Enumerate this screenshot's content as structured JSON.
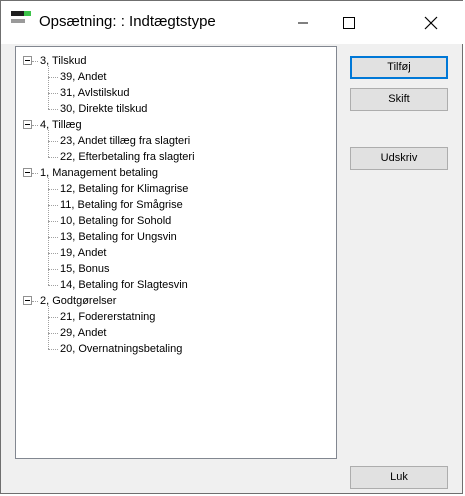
{
  "window": {
    "title": "Opsætning: : Indtægtstype"
  },
  "buttons": {
    "add": "Tilføj",
    "change": "Skift",
    "print": "Udskriv",
    "close": "Luk"
  },
  "tree": [
    {
      "label": "3, Tilskud",
      "children": [
        "39, Andet",
        "31, Avlstilskud",
        "30, Direkte tilskud"
      ]
    },
    {
      "label": "4, Tillæg",
      "children": [
        "23, Andet tillæg fra slagteri",
        "22, Efterbetaling fra slagteri"
      ]
    },
    {
      "label": "1, Management betaling",
      "children": [
        "12, Betaling for Klimagrise",
        "11, Betaling for Smågrise",
        "10, Betaling for Sohold",
        "13, Betaling for Ungsvin",
        "19, Andet",
        "15, Bonus",
        "14, Betaling for Slagtesvin"
      ]
    },
    {
      "label": "2, Godtgørelser",
      "children": [
        "21, Fodererstatning",
        "29, Andet",
        "20, Overnatningsbetaling"
      ]
    }
  ]
}
